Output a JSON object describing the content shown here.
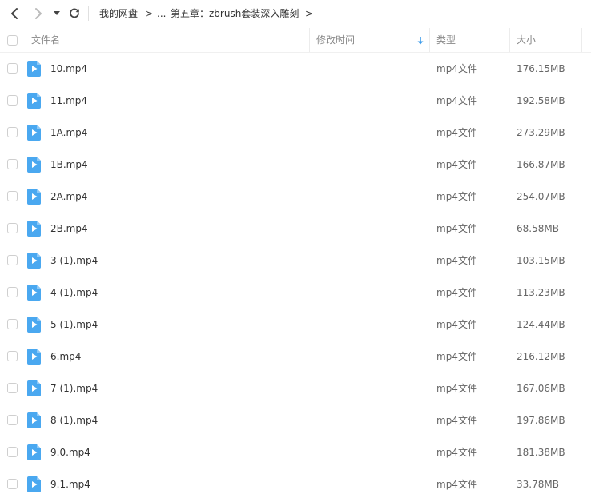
{
  "toolbar": {
    "back_icon": "chevron-left-icon",
    "forward_icon": "chevron-right-icon",
    "history_icon": "dropdown-caret-icon",
    "refresh_icon": "refresh-icon",
    "breadcrumb": {
      "root": "我的网盘",
      "separator": ">",
      "ellipsis": "...",
      "current": "第五章：zbrush套装深入雕刻"
    }
  },
  "header": {
    "name": "文件名",
    "modified": "修改时间",
    "sort_icon": "sort-down-arrow-icon",
    "type": "类型",
    "size": "大小"
  },
  "colors": {
    "accent": "#3d9be9",
    "file_icon": "#4aa8f0",
    "text": "#333333",
    "muted": "#888888"
  },
  "files": [
    {
      "name": "10.mp4",
      "modified": "",
      "type": "mp4文件",
      "size": "176.15MB"
    },
    {
      "name": "11.mp4",
      "modified": "",
      "type": "mp4文件",
      "size": "192.58MB"
    },
    {
      "name": "1A.mp4",
      "modified": "",
      "type": "mp4文件",
      "size": "273.29MB"
    },
    {
      "name": "1B.mp4",
      "modified": "",
      "type": "mp4文件",
      "size": "166.87MB"
    },
    {
      "name": "2A.mp4",
      "modified": "",
      "type": "mp4文件",
      "size": "254.07MB"
    },
    {
      "name": "2B.mp4",
      "modified": "",
      "type": "mp4文件",
      "size": "68.58MB"
    },
    {
      "name": "3 (1).mp4",
      "modified": "",
      "type": "mp4文件",
      "size": "103.15MB"
    },
    {
      "name": "4 (1).mp4",
      "modified": "",
      "type": "mp4文件",
      "size": "113.23MB"
    },
    {
      "name": "5 (1).mp4",
      "modified": "",
      "type": "mp4文件",
      "size": "124.44MB"
    },
    {
      "name": "6.mp4",
      "modified": "",
      "type": "mp4文件",
      "size": "216.12MB"
    },
    {
      "name": "7 (1).mp4",
      "modified": "",
      "type": "mp4文件",
      "size": "167.06MB"
    },
    {
      "name": "8 (1).mp4",
      "modified": "",
      "type": "mp4文件",
      "size": "197.86MB"
    },
    {
      "name": "9.0.mp4",
      "modified": "",
      "type": "mp4文件",
      "size": "181.38MB"
    },
    {
      "name": "9.1.mp4",
      "modified": "",
      "type": "mp4文件",
      "size": "33.78MB"
    }
  ]
}
